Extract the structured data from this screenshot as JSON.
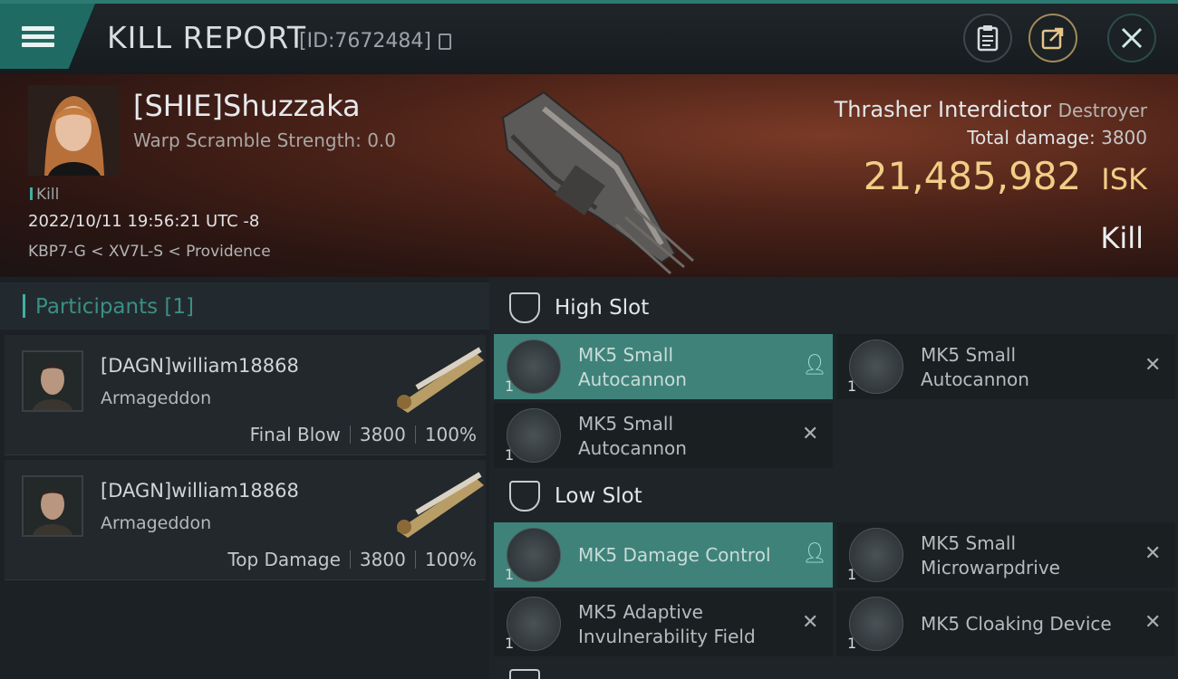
{
  "header": {
    "title": "KILL REPORT",
    "report_id": "[ID:7672484]"
  },
  "victim": {
    "pilot": "[SHIE]Shuzzaka",
    "scramble": "Warp Scramble Strength: 0.0",
    "tag": "Kill",
    "datetime": "2022/10/11 19:56:21 UTC -8",
    "route": "KBP7-G < XV7L-S < Providence",
    "ship_name": "Thrasher Interdictor",
    "ship_class": "Destroyer",
    "total_damage_label": "Total damage:",
    "total_damage": "3800",
    "isk_value": "21,485,982",
    "isk_unit": "ISK",
    "result": "Kill"
  },
  "participants": {
    "label": "Participants",
    "count": "[1]",
    "rows": [
      {
        "name": "[DAGN]william18868",
        "ship": "Armageddon",
        "role": "Final Blow",
        "damage": "3800",
        "percent": "100%"
      },
      {
        "name": "[DAGN]william18868",
        "ship": "Armageddon",
        "role": "Top Damage",
        "damage": "3800",
        "percent": "100%"
      }
    ]
  },
  "slots": {
    "high": {
      "title": "High Slot",
      "modules": [
        {
          "qty": "1",
          "name1": "MK5 Small",
          "name2": "Autocannon",
          "state": "dropped",
          "icon": "autocannon-icon"
        },
        {
          "qty": "1",
          "name1": "MK5 Small",
          "name2": "Autocannon",
          "state": "destroyed",
          "icon": "autocannon-icon"
        },
        {
          "qty": "1",
          "name1": "MK5 Small",
          "name2": "Autocannon",
          "state": "destroyed",
          "icon": "autocannon-icon"
        }
      ]
    },
    "low": {
      "title": "Low Slot",
      "modules": [
        {
          "qty": "1",
          "name1": "MK5 Damage Control",
          "name2": "",
          "state": "dropped",
          "icon": "damage-control-icon"
        },
        {
          "qty": "1",
          "name1": "MK5 Small",
          "name2": "Microwarpdrive",
          "state": "destroyed",
          "icon": "microwarpdrive-icon"
        },
        {
          "qty": "1",
          "name1": "MK5 Adaptive",
          "name2": "Invulnerability Field",
          "state": "destroyed",
          "icon": "invulnerability-field-icon"
        },
        {
          "qty": "1",
          "name1": "MK5 Cloaking Device",
          "name2": "",
          "state": "destroyed",
          "icon": "cloaking-device-icon"
        }
      ]
    }
  },
  "icons": {
    "dropped": "person-icon",
    "destroyed": "x-icon"
  },
  "colors": {
    "accent": "#3fb0a3",
    "isk": "#f1cd86",
    "active_module": "#3f8279"
  }
}
